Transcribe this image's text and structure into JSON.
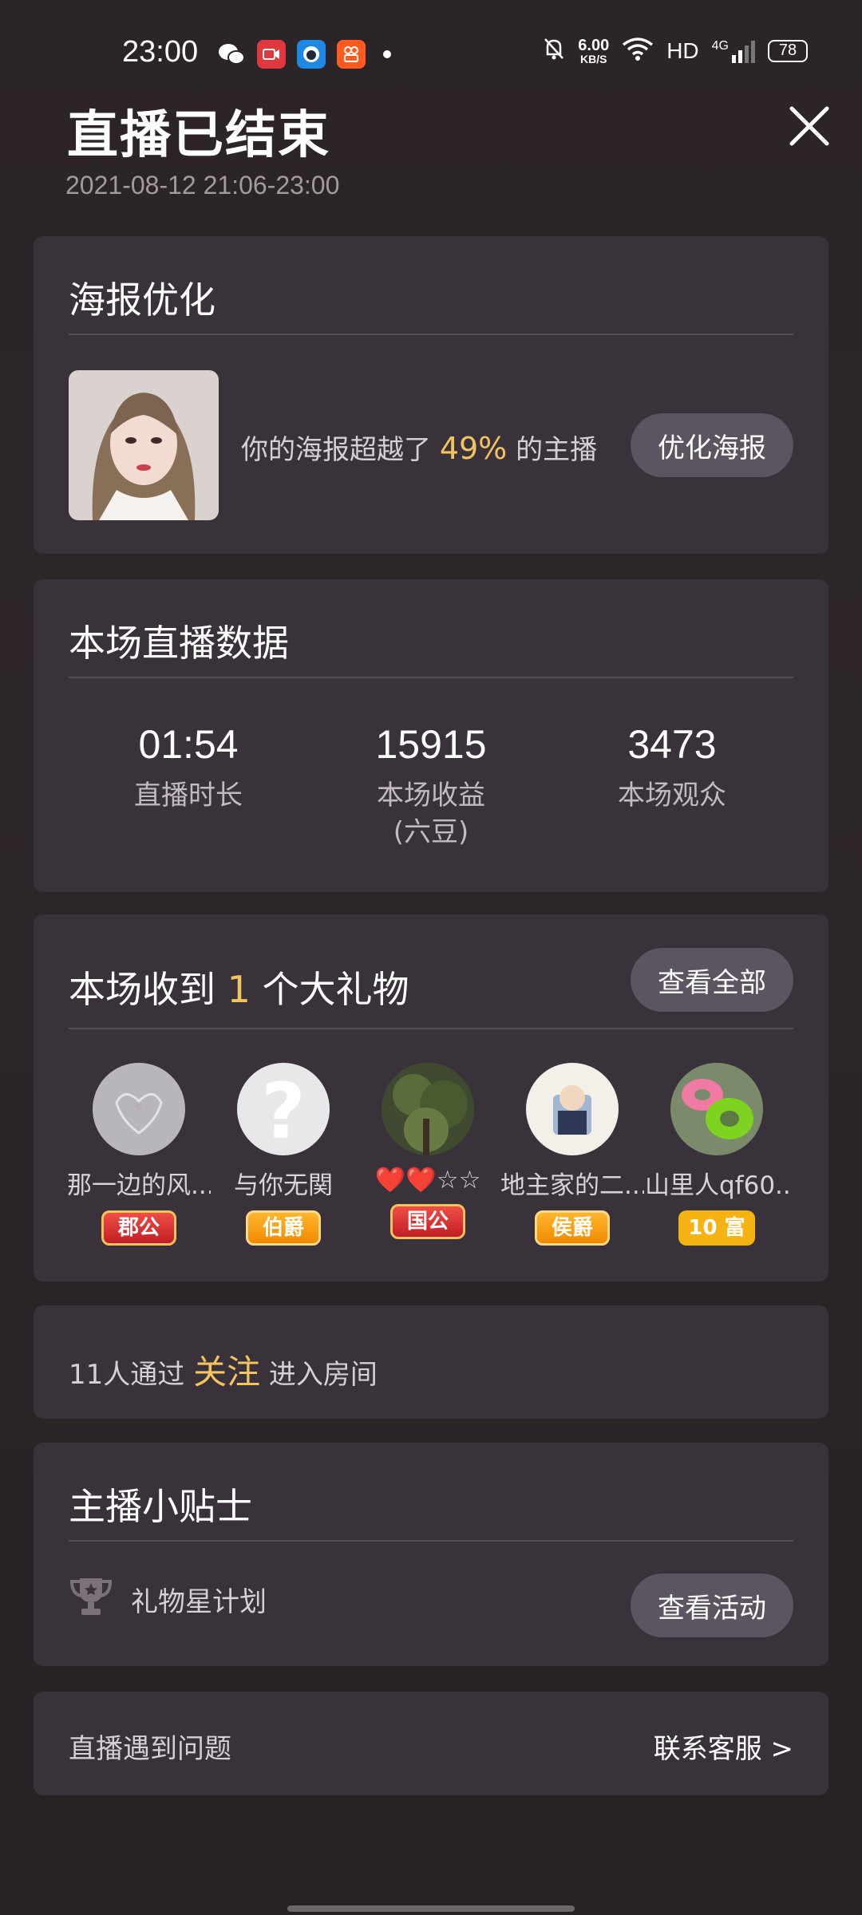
{
  "status_bar": {
    "time": "23:00",
    "net_speed_value": "6.00",
    "net_speed_unit": "KB/S",
    "hd_label": "HD",
    "network_label": "4G",
    "battery": "78",
    "icons": [
      "wechat-icon",
      "video-app-icon",
      "qq-icon",
      "kuaishou-icon",
      "notification-dot-icon",
      "mute-bell-icon",
      "wifi-icon",
      "signal-icon",
      "battery-icon"
    ]
  },
  "header": {
    "title": "直播已结束",
    "subtitle": "2021-08-12 21:06-23:00",
    "close_icon": "close-icon"
  },
  "poster_card": {
    "title": "海报优化",
    "text_before": "你的海报超越了 ",
    "percent": "49%",
    "text_after": " 的主播",
    "button": "优化海报"
  },
  "stats_card": {
    "title": "本场直播数据",
    "items": [
      {
        "value": "01:54",
        "label": "直播时长"
      },
      {
        "value": "15915",
        "label": "本场收益",
        "sub": "(六豆)"
      },
      {
        "value": "3473",
        "label": "本场观众"
      }
    ]
  },
  "gifts_card": {
    "title_before": "本场收到 ",
    "count": "1",
    "title_after": " 个大礼物",
    "button": "查看全部",
    "gifters": [
      {
        "name": "那一边的风...",
        "badge": "郡公"
      },
      {
        "name": "与你无関",
        "badge": "伯爵"
      },
      {
        "name": "❤️❤️☆☆",
        "badge": "国公"
      },
      {
        "name": "地主家的二...",
        "badge": "侯爵"
      },
      {
        "name": "山里人qf60...",
        "badge": "10 富"
      }
    ]
  },
  "follow_card": {
    "prefix": "11人通过 ",
    "highlight": "关注",
    "suffix": " 进入房间"
  },
  "tips_card": {
    "title": "主播小贴士",
    "item": "礼物星计划",
    "button": "查看活动"
  },
  "help_card": {
    "left": "直播遇到问题",
    "right": "联系客服 >"
  },
  "colors": {
    "background": "#2b2428",
    "card": "#39323a",
    "button": "#5c5461",
    "highlight": "#f2c35f"
  }
}
